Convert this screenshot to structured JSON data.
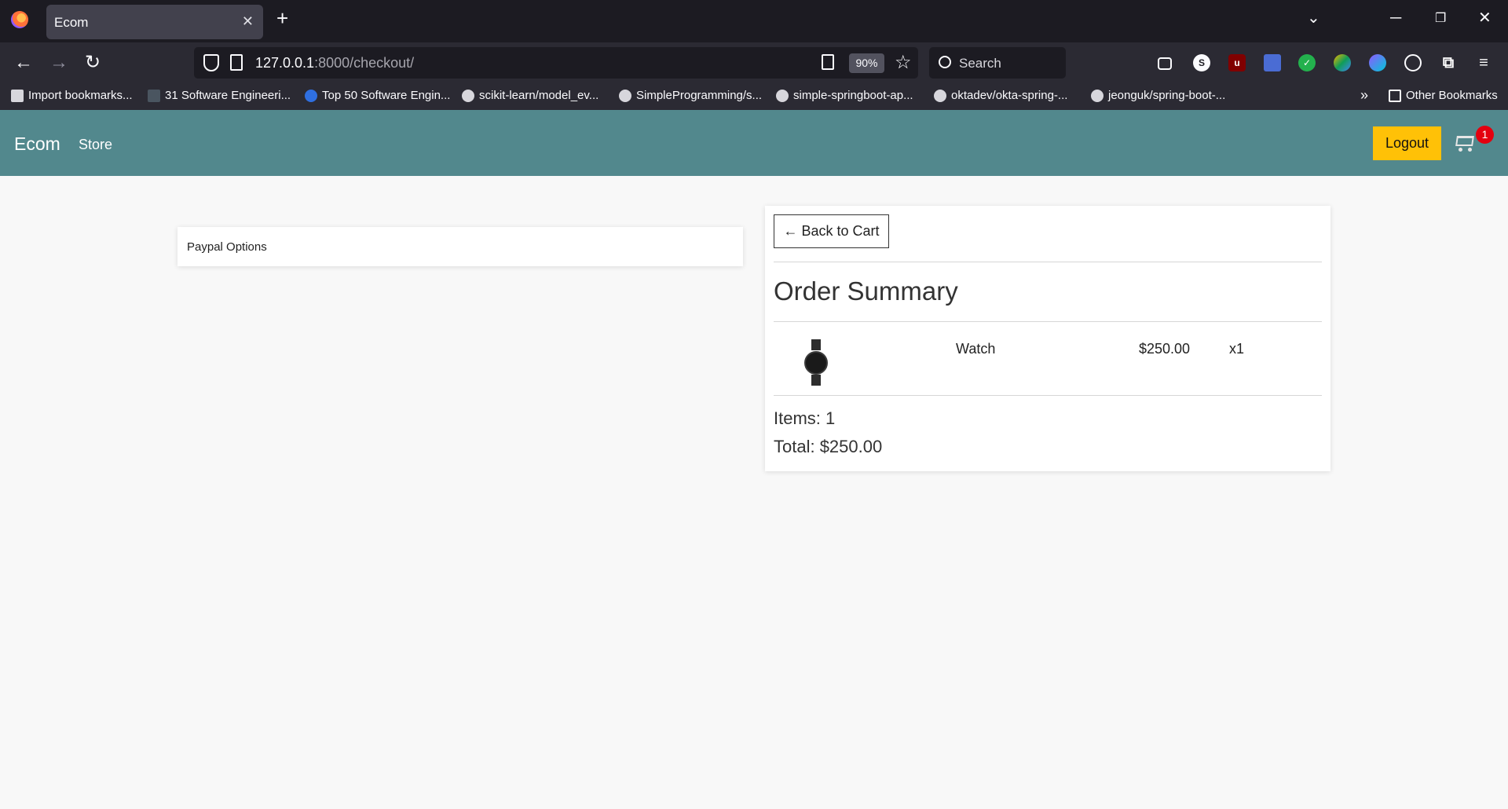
{
  "browser": {
    "tab_title": "Ecom",
    "url_host": "127.0.0.1",
    "url_path": ":8000/checkout/",
    "zoom": "90%",
    "search_placeholder": "Search",
    "bookmarks": [
      "Import bookmarks...",
      "31 Software Engineeri...",
      "Top 50 Software Engin...",
      "scikit-learn/model_ev...",
      "SimpleProgramming/s...",
      "simple-springboot-ap...",
      "oktadev/okta-spring-...",
      "jeonguk/spring-boot-..."
    ],
    "other_bookmarks": "Other Bookmarks"
  },
  "site": {
    "brand": "Ecom",
    "store_link": "Store",
    "logout_label": "Logout",
    "cart_count": "1",
    "nav_color": "#52888d",
    "logout_color": "#ffc107"
  },
  "checkout": {
    "paypal_label": "Paypal Options",
    "back_label": "← Back to Cart",
    "summary_title": "Order Summary",
    "items": [
      {
        "name": "Watch",
        "price": "$250.00",
        "qty": "x1"
      }
    ],
    "items_text": "Items: 1",
    "total_text": "Total: $250.00"
  }
}
